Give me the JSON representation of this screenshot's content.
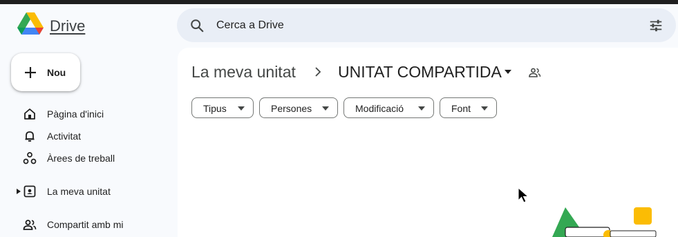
{
  "app": {
    "brand": "Drive"
  },
  "search": {
    "placeholder": "Cerca a Drive"
  },
  "sidebar": {
    "new_label": "Nou",
    "items": [
      {
        "label": "Pàgina d'inici",
        "icon": "home-icon"
      },
      {
        "label": "Activitat",
        "icon": "bell-icon"
      },
      {
        "label": "Àrees de treball",
        "icon": "workspaces-icon"
      },
      {
        "label": "La meva unitat",
        "icon": "my-drive-icon"
      },
      {
        "label": "Compartit amb mi",
        "icon": "people-icon"
      }
    ]
  },
  "breadcrumb": {
    "root": "La meva unitat",
    "current": "UNITAT COMPARTIDA"
  },
  "filters": [
    "Tipus",
    "Persones",
    "Modificació",
    "Font"
  ],
  "colors": {
    "background": "#f8fafd",
    "search_bg": "#e9eef6",
    "main_bg": "#ffffff",
    "drive_green": "#34a853",
    "drive_yellow": "#fbbc04",
    "drive_blue": "#4285f4",
    "drive_red": "#ea4335"
  }
}
